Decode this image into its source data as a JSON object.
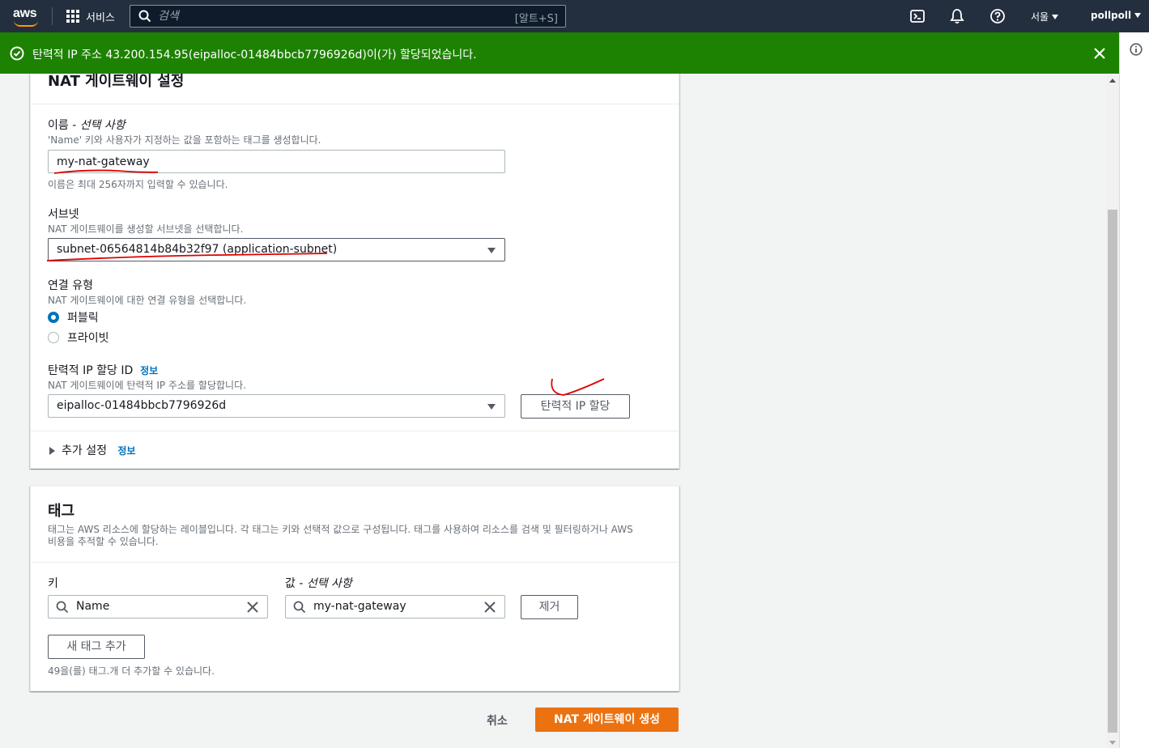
{
  "topnav": {
    "logo_text": "aws",
    "services_label": "서비스",
    "search_placeholder": "검색",
    "search_shortcut": "[알트+S]",
    "region": "서울",
    "user": "pollpoll"
  },
  "flash": {
    "message": "탄력적 IP 주소 43.200.154.95(eipalloc-01484bbcb7796926d)이(가) 할당되었습니다.",
    "color": "#1d8102"
  },
  "nat_settings": {
    "title": "NAT 게이트웨이 설정",
    "name": {
      "label": "이름 - ",
      "label_optional": "선택 사항",
      "description": "'Name' 키와 사용자가 지정하는 값을 포함하는 태그를 생성합니다.",
      "value": "my-nat-gateway",
      "hint": "이름은 최대 256자까지 입력할 수 있습니다."
    },
    "subnet": {
      "label": "서브넷",
      "description": "NAT 게이트웨이를 생성할 서브넷을 선택합니다.",
      "selected": "subnet-06564814b84b32f97 (application-subnet)"
    },
    "connectivity": {
      "label": "연결 유형",
      "description": "NAT 게이트웨이에 대한 연결 유형을 선택합니다.",
      "options": [
        "퍼블릭",
        "프라이빗"
      ],
      "selected_index": 0
    },
    "eip": {
      "label": "탄력적 IP 할당 ID",
      "info_link": "정보",
      "description": "NAT 게이트웨이에 탄력적 IP 주소를 할당합니다.",
      "selected": "eipalloc-01484bbcb7796926d",
      "allocate_button": "탄력적 IP 할당"
    },
    "additional": {
      "label": "추가 설정",
      "info_link": "정보"
    }
  },
  "tags": {
    "title": "태그",
    "description_line1": "태그는 AWS 리소스에 할당하는 레이블입니다. 각 태그는 키와 선택적 값으로 구성됩니다. 태그를 사용하여 리소스를 검색 및 필터링하거나 AWS",
    "description_line2": "비용을 추적할 수 있습니다.",
    "key_label": "키",
    "value_label": "값 - ",
    "value_optional": "선택 사항",
    "rows": [
      {
        "key": "Name",
        "value": "my-nat-gateway",
        "remove_label": "제거"
      }
    ],
    "add_button": "새 태그 추가",
    "remaining_hint": "49을(를) 태그.개 더 추가할 수 있습니다."
  },
  "footer": {
    "cancel": "취소",
    "create": "NAT 게이트웨이 생성"
  },
  "colors": {
    "nav_bg": "#232f3e",
    "primary": "#ec7211",
    "link": "#0073bb",
    "annotation": "#e00000"
  },
  "icons": [
    "search-icon",
    "services-grid-icon",
    "cloudshell-icon",
    "notifications-icon",
    "help-icon",
    "success-icon",
    "close-icon",
    "info-icon",
    "caret-down-icon",
    "clear-icon",
    "expand-icon"
  ]
}
